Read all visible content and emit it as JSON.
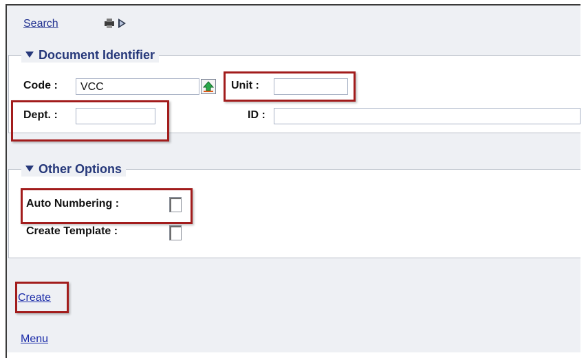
{
  "toolbar": {
    "search_link": "Search",
    "nav_icon": "print-export-icon"
  },
  "document_identifier": {
    "legend": "Document Identifier",
    "code_label": "Code :",
    "code_value": "VCC",
    "lookup_icon": "green-up-arrow-icon",
    "unit_label": "Unit :",
    "unit_value": "",
    "dept_label": "Dept. :",
    "dept_value": "",
    "id_label": "ID :",
    "id_value": ""
  },
  "other_options": {
    "legend": "Other Options",
    "auto_numbering_label": "Auto Numbering :",
    "auto_numbering_checked": false,
    "create_template_label": "Create Template :",
    "create_template_checked": false
  },
  "actions": {
    "create_link": "Create",
    "menu_link": "Menu"
  },
  "colors": {
    "highlight": "#a21c1c",
    "link": "#1a2ba8",
    "legend": "#26387a"
  }
}
